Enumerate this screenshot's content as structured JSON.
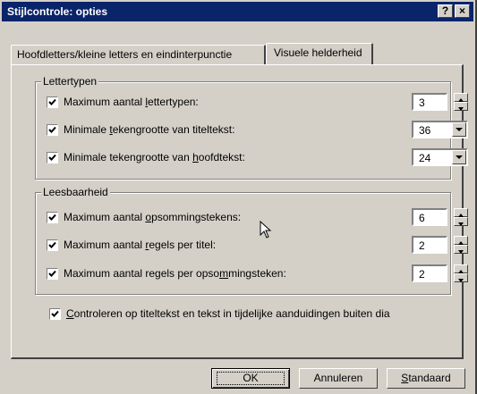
{
  "window": {
    "title": "Stijlcontrole: opties",
    "help_label": "?",
    "close_label": "×"
  },
  "tabs": [
    {
      "label": "Hoofdletters/kleine letters en eindinterpunctie",
      "active": false
    },
    {
      "label": "Visuele helderheid",
      "active": true
    }
  ],
  "fonts_group": {
    "legend": "Lettertypen",
    "rows": [
      {
        "pre": "Maximum aantal ",
        "key": "l",
        "post": "ettertypen:",
        "checked": true,
        "value": "3",
        "control": "spinner"
      },
      {
        "pre": "Minimale ",
        "key": "t",
        "post": "ekengrootte van titeltekst:",
        "checked": true,
        "value": "36",
        "control": "dropdown"
      },
      {
        "pre": "Minimale tekengrootte van ",
        "key": "h",
        "post": "oofdtekst:",
        "checked": true,
        "value": "24",
        "control": "dropdown"
      }
    ]
  },
  "readability_group": {
    "legend": "Leesbaarheid",
    "rows": [
      {
        "pre": "Maximum aantal ",
        "key": "o",
        "post": "psommingstekens:",
        "checked": true,
        "value": "6",
        "control": "spinner"
      },
      {
        "pre": "Maximum aantal ",
        "key": "r",
        "post": "egels per titel:",
        "checked": true,
        "value": "2",
        "control": "spinner"
      },
      {
        "pre": "Maximum aantal regels per opso",
        "key": "m",
        "post": "mingsteken:",
        "checked": true,
        "value": "2",
        "control": "spinner"
      }
    ]
  },
  "check_placeholders": {
    "pre": "",
    "key": "C",
    "post": "ontroleren op titeltekst en tekst in tijdelijke aanduidingen buiten dia",
    "checked": true
  },
  "buttons": {
    "ok": "OK",
    "cancel": "Annuleren",
    "default_pre": "",
    "default_key": "S",
    "default_post": "tandaard"
  },
  "colors": {
    "titlebar": "#0a246a",
    "face": "#d4d0c8"
  }
}
